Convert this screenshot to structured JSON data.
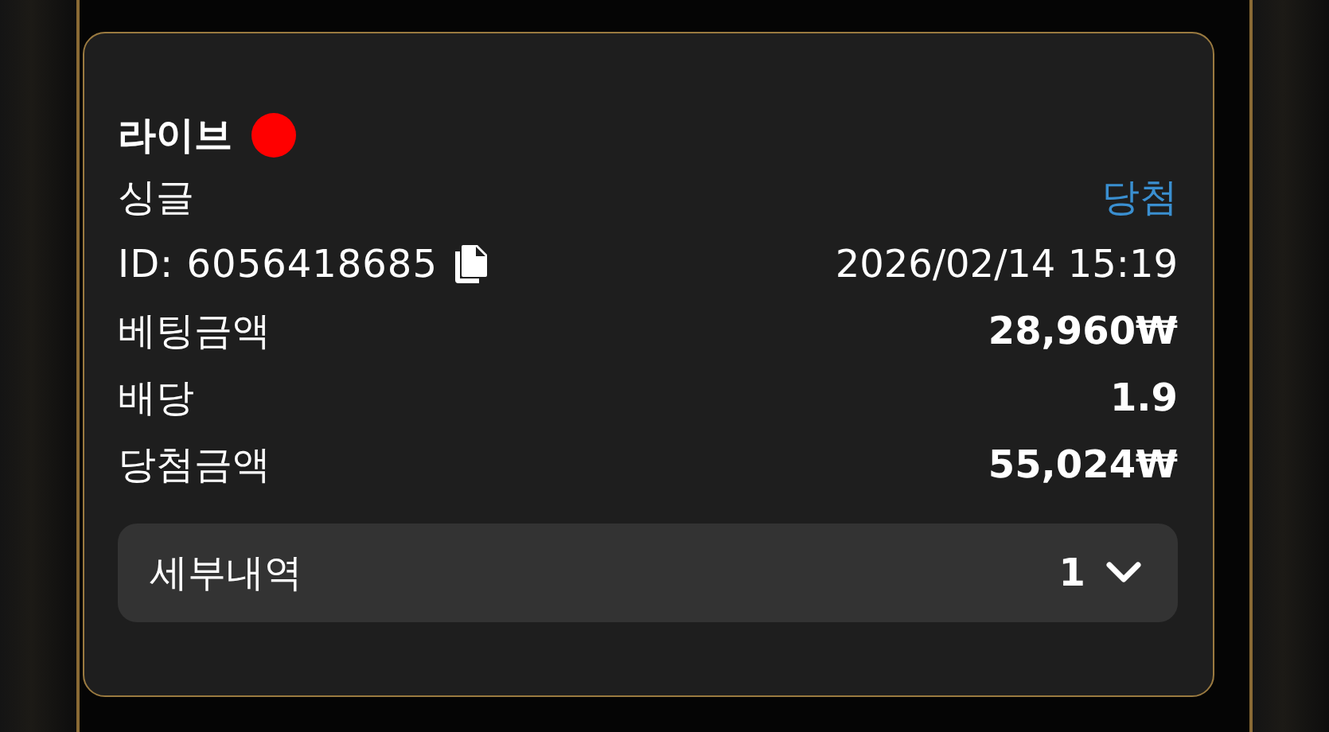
{
  "header": {
    "title": "라이브",
    "live": true
  },
  "rows": [
    {
      "kind": "status",
      "label": "싱글",
      "value": "당첨"
    },
    {
      "kind": "id",
      "label": "ID: 6056418685",
      "value": "2026/02/14 15:19"
    },
    {
      "kind": "amount",
      "label": "베팅금액",
      "value": "28,960₩"
    },
    {
      "kind": "amount",
      "label": "배당",
      "value": "1.9"
    },
    {
      "kind": "amount",
      "label": "당첨금액",
      "value": "55,024₩"
    }
  ],
  "details": {
    "label": "세부내역",
    "count": "1",
    "expanded": false
  }
}
